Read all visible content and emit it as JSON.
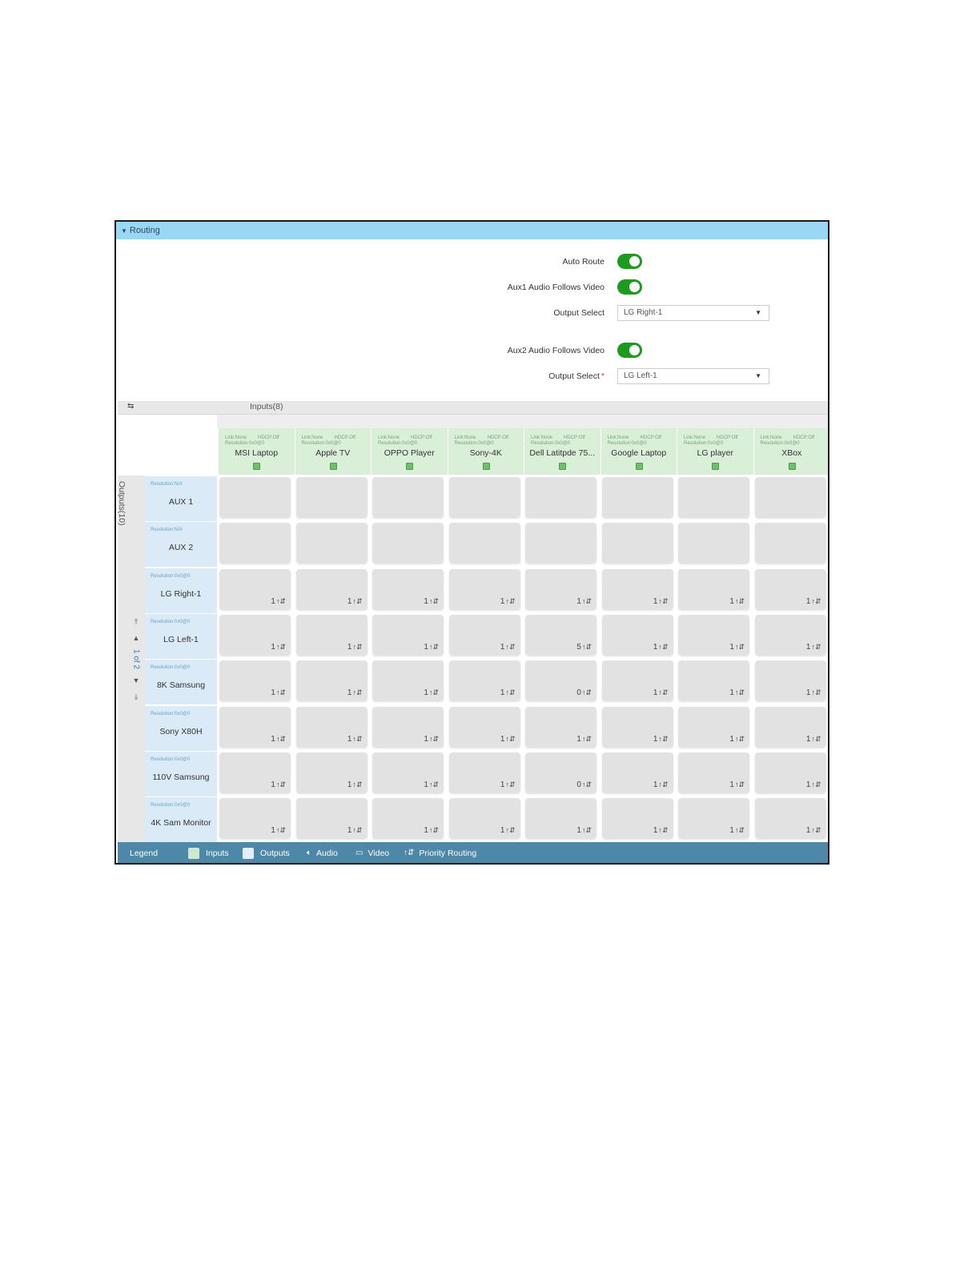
{
  "panel": {
    "title": "Routing",
    "auto_route_label": "Auto Route",
    "aux1_label": "Aux1 Audio Follows Video",
    "output_select_label_1": "Output Select",
    "output_select_value_1": "LG Right-1",
    "aux2_label": "Aux2 Audio Follows Video",
    "output_select_label_2": "Output Select",
    "required_mark": "*",
    "output_select_value_2": "LG Left-1",
    "toggles": {
      "auto_route": true,
      "aux1_follows": true,
      "aux2_follows": true
    }
  },
  "grid": {
    "inputs_title": "Inputs(8)",
    "outputs_title": "Outputs(10)",
    "pager_text": "1 of 2",
    "priority_glyph": "↑⇵",
    "inputs": [
      {
        "name": "MSI Laptop",
        "link": "Link:None",
        "hdcp": "HDCP:Off",
        "res": "Resolution:0x0@0"
      },
      {
        "name": "Apple TV",
        "link": "Link:None",
        "hdcp": "HDCP:Off",
        "res": "Resolution:0x0@0"
      },
      {
        "name": "OPPO Player",
        "link": "Link:None",
        "hdcp": "HDCP:Off",
        "res": "Resolution:0x0@0"
      },
      {
        "name": "Sony-4K",
        "link": "Link:None",
        "hdcp": "HDCP:Off",
        "res": "Resolution:0x0@0"
      },
      {
        "name": "Dell Latitpde 75...",
        "link": "Link:None",
        "hdcp": "HDCP:Off",
        "res": "Resolution:0x0@0"
      },
      {
        "name": "Google Laptop",
        "link": "Link:None",
        "hdcp": "HDCP:Off",
        "res": "Resolution:0x0@0"
      },
      {
        "name": "LG player",
        "link": "Link:None",
        "hdcp": "HDCP:Off",
        "res": "Resolution:0x0@0"
      },
      {
        "name": "XBox",
        "link": "Link:None",
        "hdcp": "HDCP:Off",
        "res": "Resolution:0x0@0"
      }
    ],
    "outputs": [
      {
        "name": "AUX 1",
        "res": "Resolution:N/A",
        "cells": [
          "",
          "",
          "",
          "",
          "",
          "",
          "",
          ""
        ]
      },
      {
        "name": "AUX 2",
        "res": "Resolution:N/A",
        "cells": [
          "",
          "",
          "",
          "",
          "",
          "",
          "",
          ""
        ]
      },
      {
        "name": "LG Right-1",
        "res": "Resolution:0x0@0",
        "cells": [
          "1",
          "1",
          "1",
          "1",
          "1",
          "1",
          "1",
          "1"
        ]
      },
      {
        "name": "LG Left-1",
        "res": "Resolution:0x0@0",
        "cells": [
          "1",
          "1",
          "1",
          "1",
          "5",
          "1",
          "1",
          "1"
        ]
      },
      {
        "name": "8K Samsung",
        "res": "Resolution:0x0@0",
        "cells": [
          "1",
          "1",
          "1",
          "1",
          "0",
          "1",
          "1",
          "1"
        ]
      },
      {
        "name": "Sony X80H",
        "res": "Resolution:0x0@0",
        "cells": [
          "1",
          "1",
          "1",
          "1",
          "1",
          "1",
          "1",
          "1"
        ]
      },
      {
        "name": "110V Samsung",
        "res": "Resolution:0x0@0",
        "cells": [
          "1",
          "1",
          "1",
          "1",
          "0",
          "1",
          "1",
          "1"
        ]
      },
      {
        "name": "4K Sam Monitor",
        "res": "Resolution:0x0@0",
        "cells": [
          "1",
          "1",
          "1",
          "1",
          "1",
          "1",
          "1",
          "1"
        ]
      }
    ]
  },
  "legend": {
    "title": "Legend",
    "inputs": "Inputs",
    "outputs": "Outputs",
    "audio": "Audio",
    "video": "Video",
    "priority": "Priority Routing",
    "colors": {
      "inputs": "#cfe9cf",
      "outputs": "#e4eef8"
    }
  }
}
